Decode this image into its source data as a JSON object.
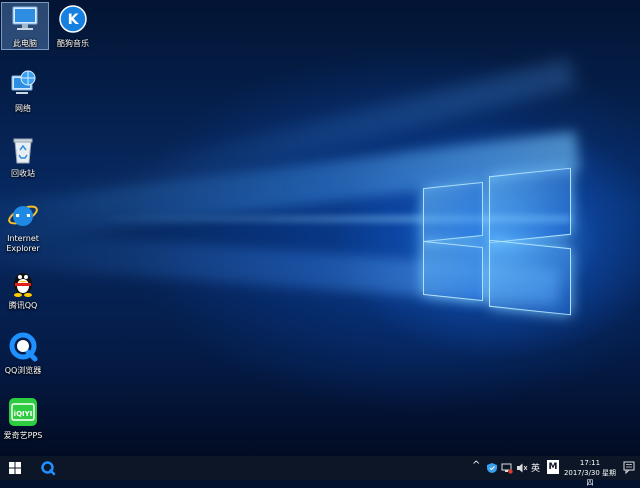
{
  "desktop": {
    "icons": [
      {
        "label": "此电脑",
        "icon": "computer-icon"
      },
      {
        "label": "酷狗音乐",
        "icon": "kugou-music-icon"
      },
      {
        "label": "网络",
        "icon": "network-icon"
      },
      {
        "label": "回收站",
        "icon": "recycle-bin-icon"
      },
      {
        "label": "Internet",
        "label2": "Explorer",
        "icon": "internet-explorer-icon"
      },
      {
        "label": "腾讯QQ",
        "icon": "qq-penguin-icon"
      },
      {
        "label": "QQ浏览器",
        "icon": "qq-browser-icon"
      },
      {
        "label": "爱奇艺PPS",
        "icon": "iqiyi-icon"
      }
    ],
    "kugou_letter": "K",
    "iqiyi_text": "iQIYI"
  },
  "taskbar": {
    "start": "windows-start-icon",
    "pinned": "qq-browser-taskbar-icon",
    "tray": {
      "chevron": "^",
      "ime_label": "英",
      "ime_mode": "M"
    },
    "clock": {
      "time": "17:11",
      "date": "2017/3/30 星期四"
    }
  },
  "colors": {
    "taskbar_bg": "#0c1626",
    "accent_blue": "#1e88e5",
    "qq_yellow": "#ffcc00",
    "iqiyi_green": "#2ecc40"
  }
}
